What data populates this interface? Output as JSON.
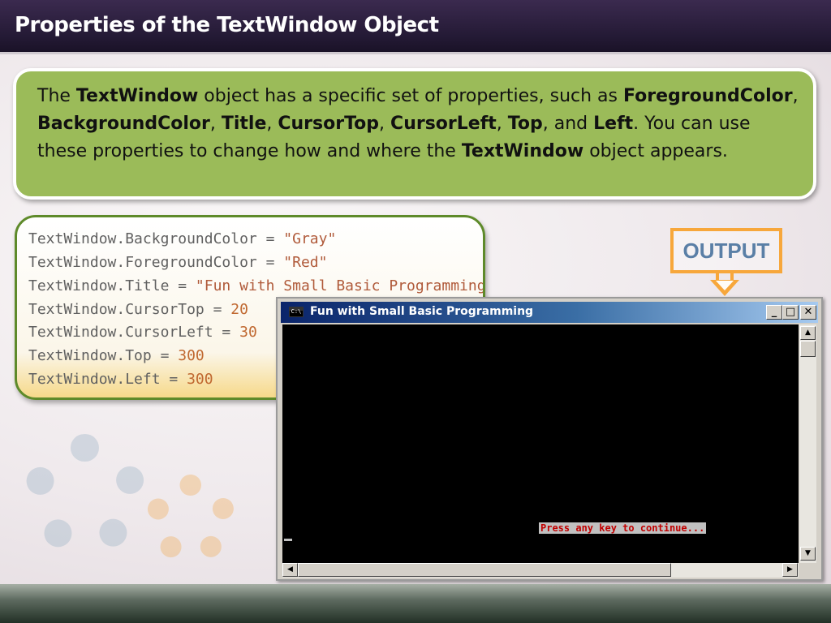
{
  "slide": {
    "title": "Properties of the TextWindow Object",
    "colors": {
      "header": "#2a1e3b",
      "bubble": "#9bbb59",
      "output_border": "#f7a73b",
      "output_text": "#5a7fa6"
    }
  },
  "intro": {
    "t1": "The ",
    "b1": "TextWindow",
    "t2": " object has a specific set of properties, such as ",
    "b2": "ForegroundColor",
    "t3": ", ",
    "b3": "BackgroundColor",
    "t4": ", ",
    "b4": "Title",
    "t5": ", ",
    "b5": "CursorTop",
    "t6": ", ",
    "b6": "CursorLeft",
    "t7": ", ",
    "b7": "Top",
    "t8": ", and ",
    "b8": "Left",
    "t9": ". You can use these properties to change how and where the ",
    "b9": "TextWindow",
    "t10": " object appears."
  },
  "code": [
    {
      "obj": "TextWindow.",
      "prop": "BackgroundColor",
      "op": " = ",
      "val": "\"Gray\"",
      "kind": "str"
    },
    {
      "obj": "TextWindow.",
      "prop": "ForegroundColor",
      "op": " = ",
      "val": "\"Red\"",
      "kind": "str"
    },
    {
      "obj": "TextWindow.",
      "prop": "Title",
      "op": " = ",
      "val": "\"Fun with Small Basic Programming\"",
      "kind": "str"
    },
    {
      "obj": "TextWindow.",
      "prop": "CursorTop",
      "op": " = ",
      "val": "20",
      "kind": "num"
    },
    {
      "obj": "TextWindow.",
      "prop": "CursorLeft",
      "op": " = ",
      "val": "30",
      "kind": "num"
    },
    {
      "obj": "TextWindow.",
      "prop": "Top",
      "op": " = ",
      "val": "300",
      "kind": "num"
    },
    {
      "obj": "TextWindow.",
      "prop": "Left",
      "op": " = ",
      "val": "300",
      "kind": "num"
    }
  ],
  "output_label": "OUTPUT",
  "window": {
    "icon_text": "C:\\",
    "title": "Fun with Small Basic Programming",
    "minimize": "_",
    "maximize": "□",
    "close": "✕",
    "console_message": "Press any key to continue...",
    "scroll_up": "▲",
    "scroll_down": "▼",
    "scroll_left": "◀",
    "scroll_right": "▶"
  }
}
